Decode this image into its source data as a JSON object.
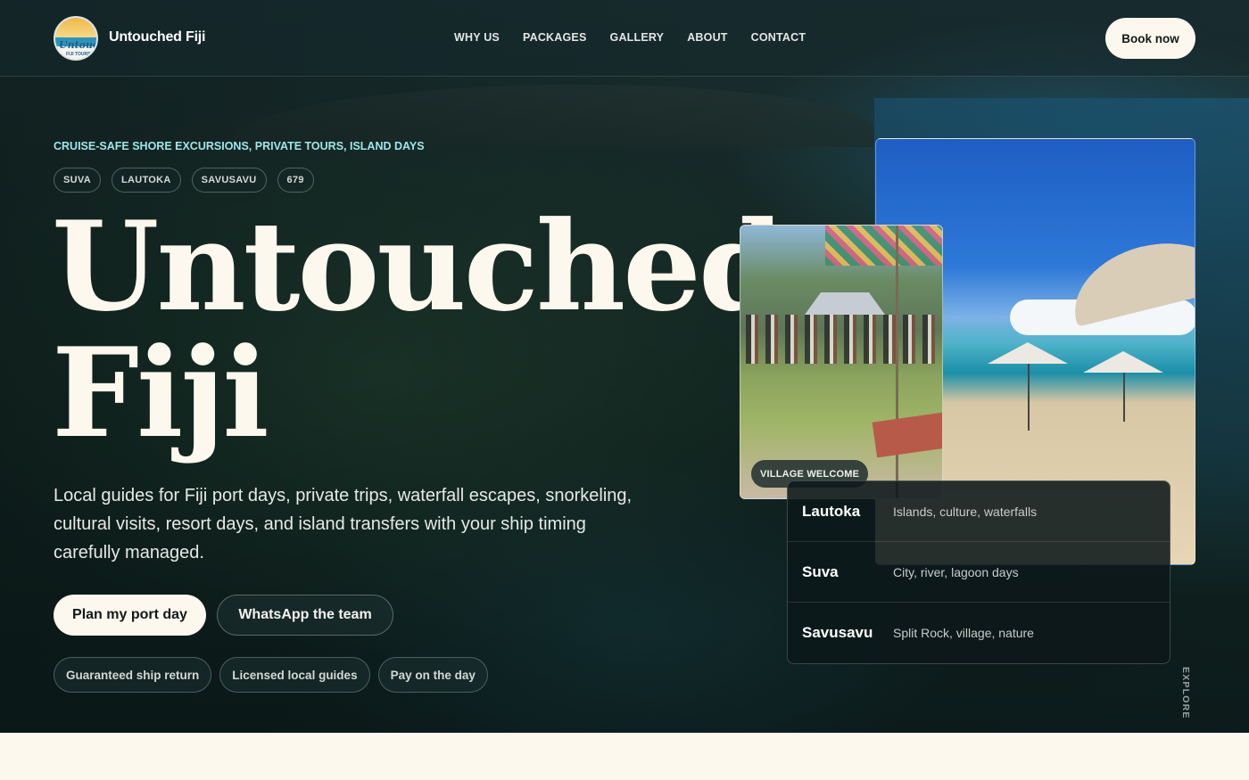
{
  "brand": {
    "name": "Untouched Fiji",
    "logo_script": "Untouched",
    "logo_small": "FIJI TOURS"
  },
  "nav": {
    "links": [
      "WHY US",
      "PACKAGES",
      "GALLERY",
      "ABOUT",
      "CONTACT"
    ],
    "book_label": "Book now"
  },
  "hero": {
    "eyebrow": "CRUISE-SAFE SHORE EXCURSIONS, PRIVATE TOURS, ISLAND DAYS",
    "chips": [
      "SUVA",
      "LAUTOKA",
      "SAVUSAVU",
      "679"
    ],
    "title_line1": "Untouched",
    "title_line2": "Fiji",
    "lead": "Local guides for Fiji port days, private trips, waterfall escapes, snorkeling, cultural visits, resort days, and island transfers with your ship timing carefully managed.",
    "cta_primary": "Plan my port day",
    "cta_secondary": "WhatsApp the team",
    "badges": [
      "Guaranteed ship return",
      "Licensed local guides",
      "Pay on the day"
    ]
  },
  "photos": {
    "village_tag": "VILLAGE WELCOME"
  },
  "explore": {
    "rows": [
      {
        "port": "Lautoka",
        "desc": "Islands, culture, waterfalls"
      },
      {
        "port": "Suva",
        "desc": "City, river, lagoon days"
      },
      {
        "port": "Savusavu",
        "desc": "Split Rock, village, nature"
      }
    ],
    "vertical_label": "EXPLORE"
  },
  "colors": {
    "accent_eyebrow": "#9fe6ea",
    "cream": "#fdf8ee",
    "hero_dark": "#12241f"
  }
}
